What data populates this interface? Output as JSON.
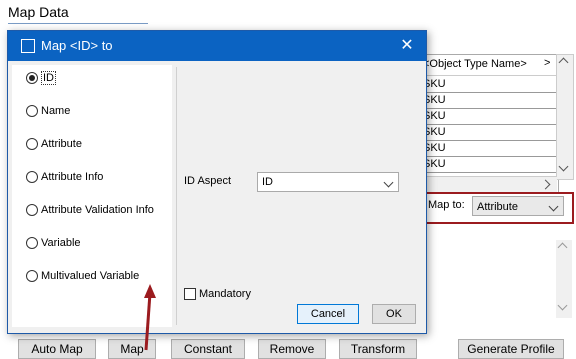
{
  "background": {
    "title": "Map Data",
    "grid_header": "<Object Type Name>",
    "grid_rows": [
      "SKU",
      "SKU",
      "SKU",
      "SKU",
      "SKU",
      "SKU"
    ],
    "map_to_label": "Map to:",
    "map_to_value": "Attribute",
    "bottom_buttons": [
      "Auto Map",
      "Map",
      "Constant",
      "Remove",
      "Transform",
      "Generate Profile"
    ]
  },
  "dialog": {
    "title": "Map <ID> to",
    "close_label": "✕",
    "options": [
      "ID",
      "Name",
      "Attribute",
      "Attribute Info",
      "Attribute Validation Info",
      "Variable",
      "Multivalued Variable"
    ],
    "selected_option": "ID",
    "id_aspect_label": "ID Aspect",
    "id_aspect_value": "ID",
    "mandatory_label": "Mandatory",
    "mandatory_checked": false,
    "cancel_label": "Cancel",
    "ok_label": "OK"
  },
  "colors": {
    "title_bar": "#0b63c2",
    "highlight_border": "#9b1b1f",
    "arrow": "#9b1b1f"
  }
}
